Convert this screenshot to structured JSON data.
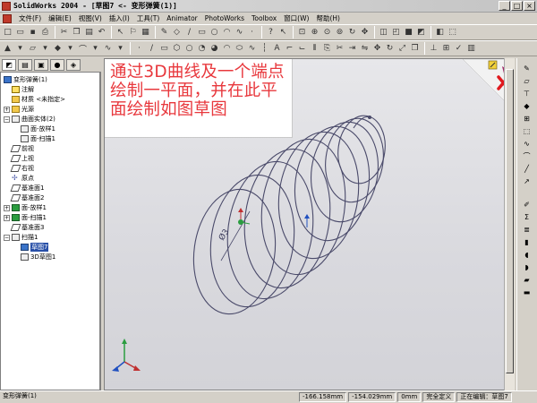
{
  "window": {
    "title": "SolidWorks 2004 - [草图7 <- 变形弹簧(1)]",
    "buttons": {
      "minimize": "_",
      "restore": "□",
      "close": "×"
    }
  },
  "menubar": {
    "items": [
      "文件(F)",
      "编辑(E)",
      "视图(V)",
      "插入(I)",
      "工具(T)",
      "Animator",
      "PhotoWorks",
      "Toolbox",
      "窗口(W)",
      "帮助(H)"
    ]
  },
  "tree": {
    "root": "变形弹簧(1)",
    "items": [
      "注解",
      "材质 <未指定>",
      "光源",
      "曲面实体(2)",
      "面-放样1",
      "面-扫描1",
      "前视",
      "上视",
      "右视",
      "原点",
      "基准面1",
      "基准面2",
      "面-放样1",
      "面-扫描1",
      "基准面3",
      "扫描1",
      "草图7",
      "3D草图1"
    ]
  },
  "viewport": {
    "instruction": "通过3D曲线及一个端点绘制一平面，并在此平面绘制如图草图",
    "dimension": "Ø3"
  },
  "statusbar": {
    "doc_name": "变形弹簧(1)",
    "x_coord": "-166.158mm",
    "y_coord": "-154.029mm",
    "z_coord": "0mm",
    "state": "完全定义",
    "editing": "正在编辑：草图7"
  },
  "colors": {
    "instruction_text": "#e8383d",
    "helix_stroke": "#4a4a6a",
    "selection": "#2950a8",
    "viewport_bg": "#e2e2e6"
  }
}
